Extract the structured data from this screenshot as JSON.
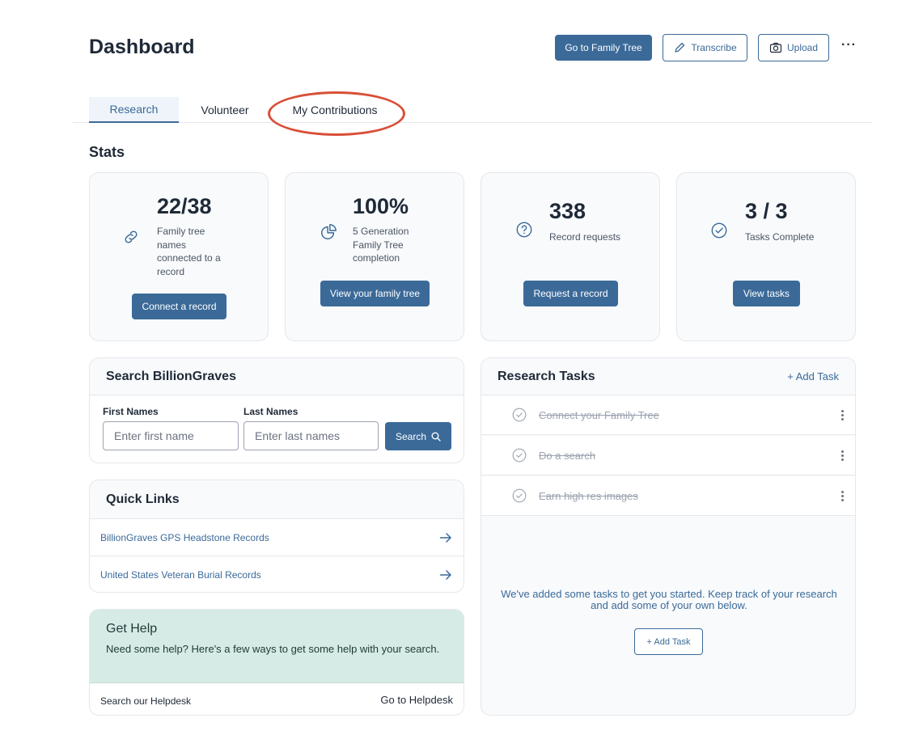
{
  "header": {
    "title": "Dashboard",
    "go_family_tree": "Go to Family Tree",
    "transcribe": "Transcribe",
    "upload": "Upload",
    "more": "···"
  },
  "tabs": [
    {
      "label": "Research",
      "active": true
    },
    {
      "label": "Volunteer",
      "active": false
    },
    {
      "label": "My Contributions",
      "active": false
    }
  ],
  "stats": {
    "title": "Stats",
    "cards": [
      {
        "value": "22/38",
        "desc_lines": [
          "Family tree",
          "names",
          "connected to a",
          "record"
        ],
        "icon": "link-icon",
        "button": "Connect a record"
      },
      {
        "value": "100%",
        "desc_lines": [
          "5 Generation",
          "Family Tree",
          "completion"
        ],
        "icon": "pie-chart-icon",
        "button": "View your family tree"
      },
      {
        "value": "338",
        "desc_lines": [
          "Record requests"
        ],
        "icon": "question-icon",
        "button": "Request a record"
      },
      {
        "value": "3 / 3",
        "desc_lines": [
          "Tasks Complete"
        ],
        "icon": "check-circle-icon",
        "button": "View tasks"
      }
    ]
  },
  "search": {
    "title": "Search BillionGraves",
    "first_label": "First Names",
    "first_placeholder": "Enter first name",
    "last_label": "Last Names",
    "last_placeholder": "Enter last names",
    "button": "Search"
  },
  "quick_links": {
    "title": "Quick Links",
    "items": [
      {
        "label": "BillionGraves GPS Headstone Records"
      },
      {
        "label": "United States Veteran Burial Records"
      }
    ]
  },
  "help": {
    "title": "Get Help",
    "text": "Need some help? Here's a few ways to get some help with your search.",
    "footer_left": "Search our Helpdesk",
    "footer_right": "Go to Helpdesk"
  },
  "research_tasks": {
    "title": "Research Tasks",
    "add_link": "+ Add Task",
    "items": [
      {
        "label": "Connect your Family Tree",
        "done": true
      },
      {
        "label": "Do a search",
        "done": true
      },
      {
        "label": "Earn high res images",
        "done": true
      }
    ],
    "empty_text": "We've added some tasks to get you started. Keep track of your research and add some of your own below.",
    "add_button": "+ Add Task"
  },
  "colors": {
    "primary": "#3b6a99",
    "help_bg": "#d6ebe5",
    "annotation_circle": "#d94f38"
  }
}
